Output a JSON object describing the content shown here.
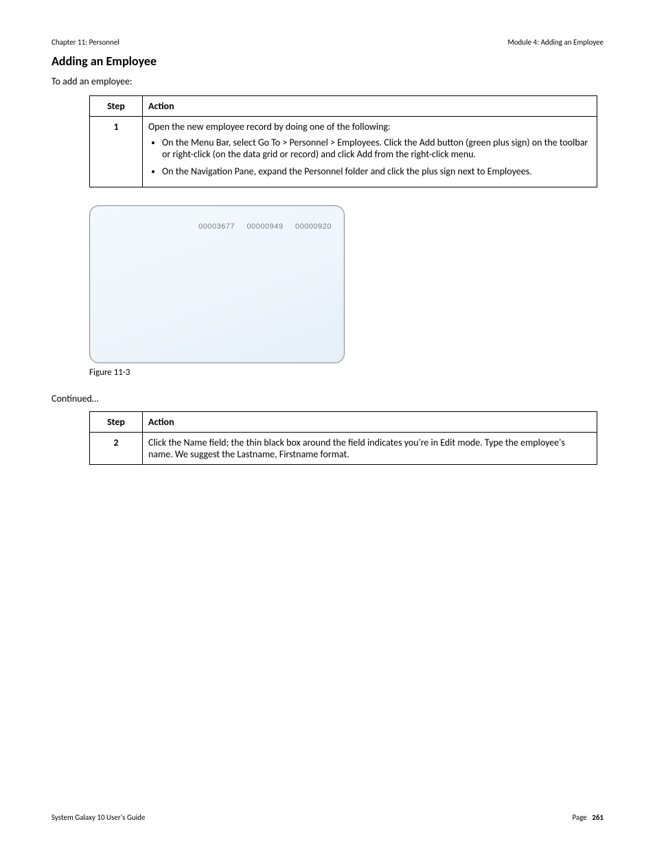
{
  "header": {
    "left": "Chapter 11: Personnel",
    "right": "Module 4: Adding an Employee"
  },
  "section": {
    "title": "Adding an Employee",
    "intro": "To add an employee:"
  },
  "table1": {
    "head": {
      "step": "Step",
      "action": "Action"
    },
    "row": {
      "step": "1",
      "action_lead": "Open the new employee record by doing one of the following:",
      "bullets": [
        "On the Menu Bar, select Go To > Personnel > Employees. Click the Add button (green plus sign) on the toolbar or right-click (on the data grid or record) and click Add from the right-click menu.",
        "On the Navigation Pane, expand the Personnel folder and click the plus sign next to Employees."
      ]
    }
  },
  "card": {
    "numbers": [
      "00003677",
      "00000949",
      "00000920"
    ],
    "caption": "Figure 11-3"
  },
  "continued": "Continued…",
  "table2": {
    "head": {
      "step": "Step",
      "action": "Action"
    },
    "row": {
      "step": "2",
      "action": "Click the Name field; the thin black box around the field indicates you're in Edit mode. Type the employee's name. We suggest the Lastname, Firstname format."
    }
  },
  "footer": {
    "left": "System Galaxy 10 User's Guide",
    "right_label": "Page",
    "right_num": "261"
  }
}
